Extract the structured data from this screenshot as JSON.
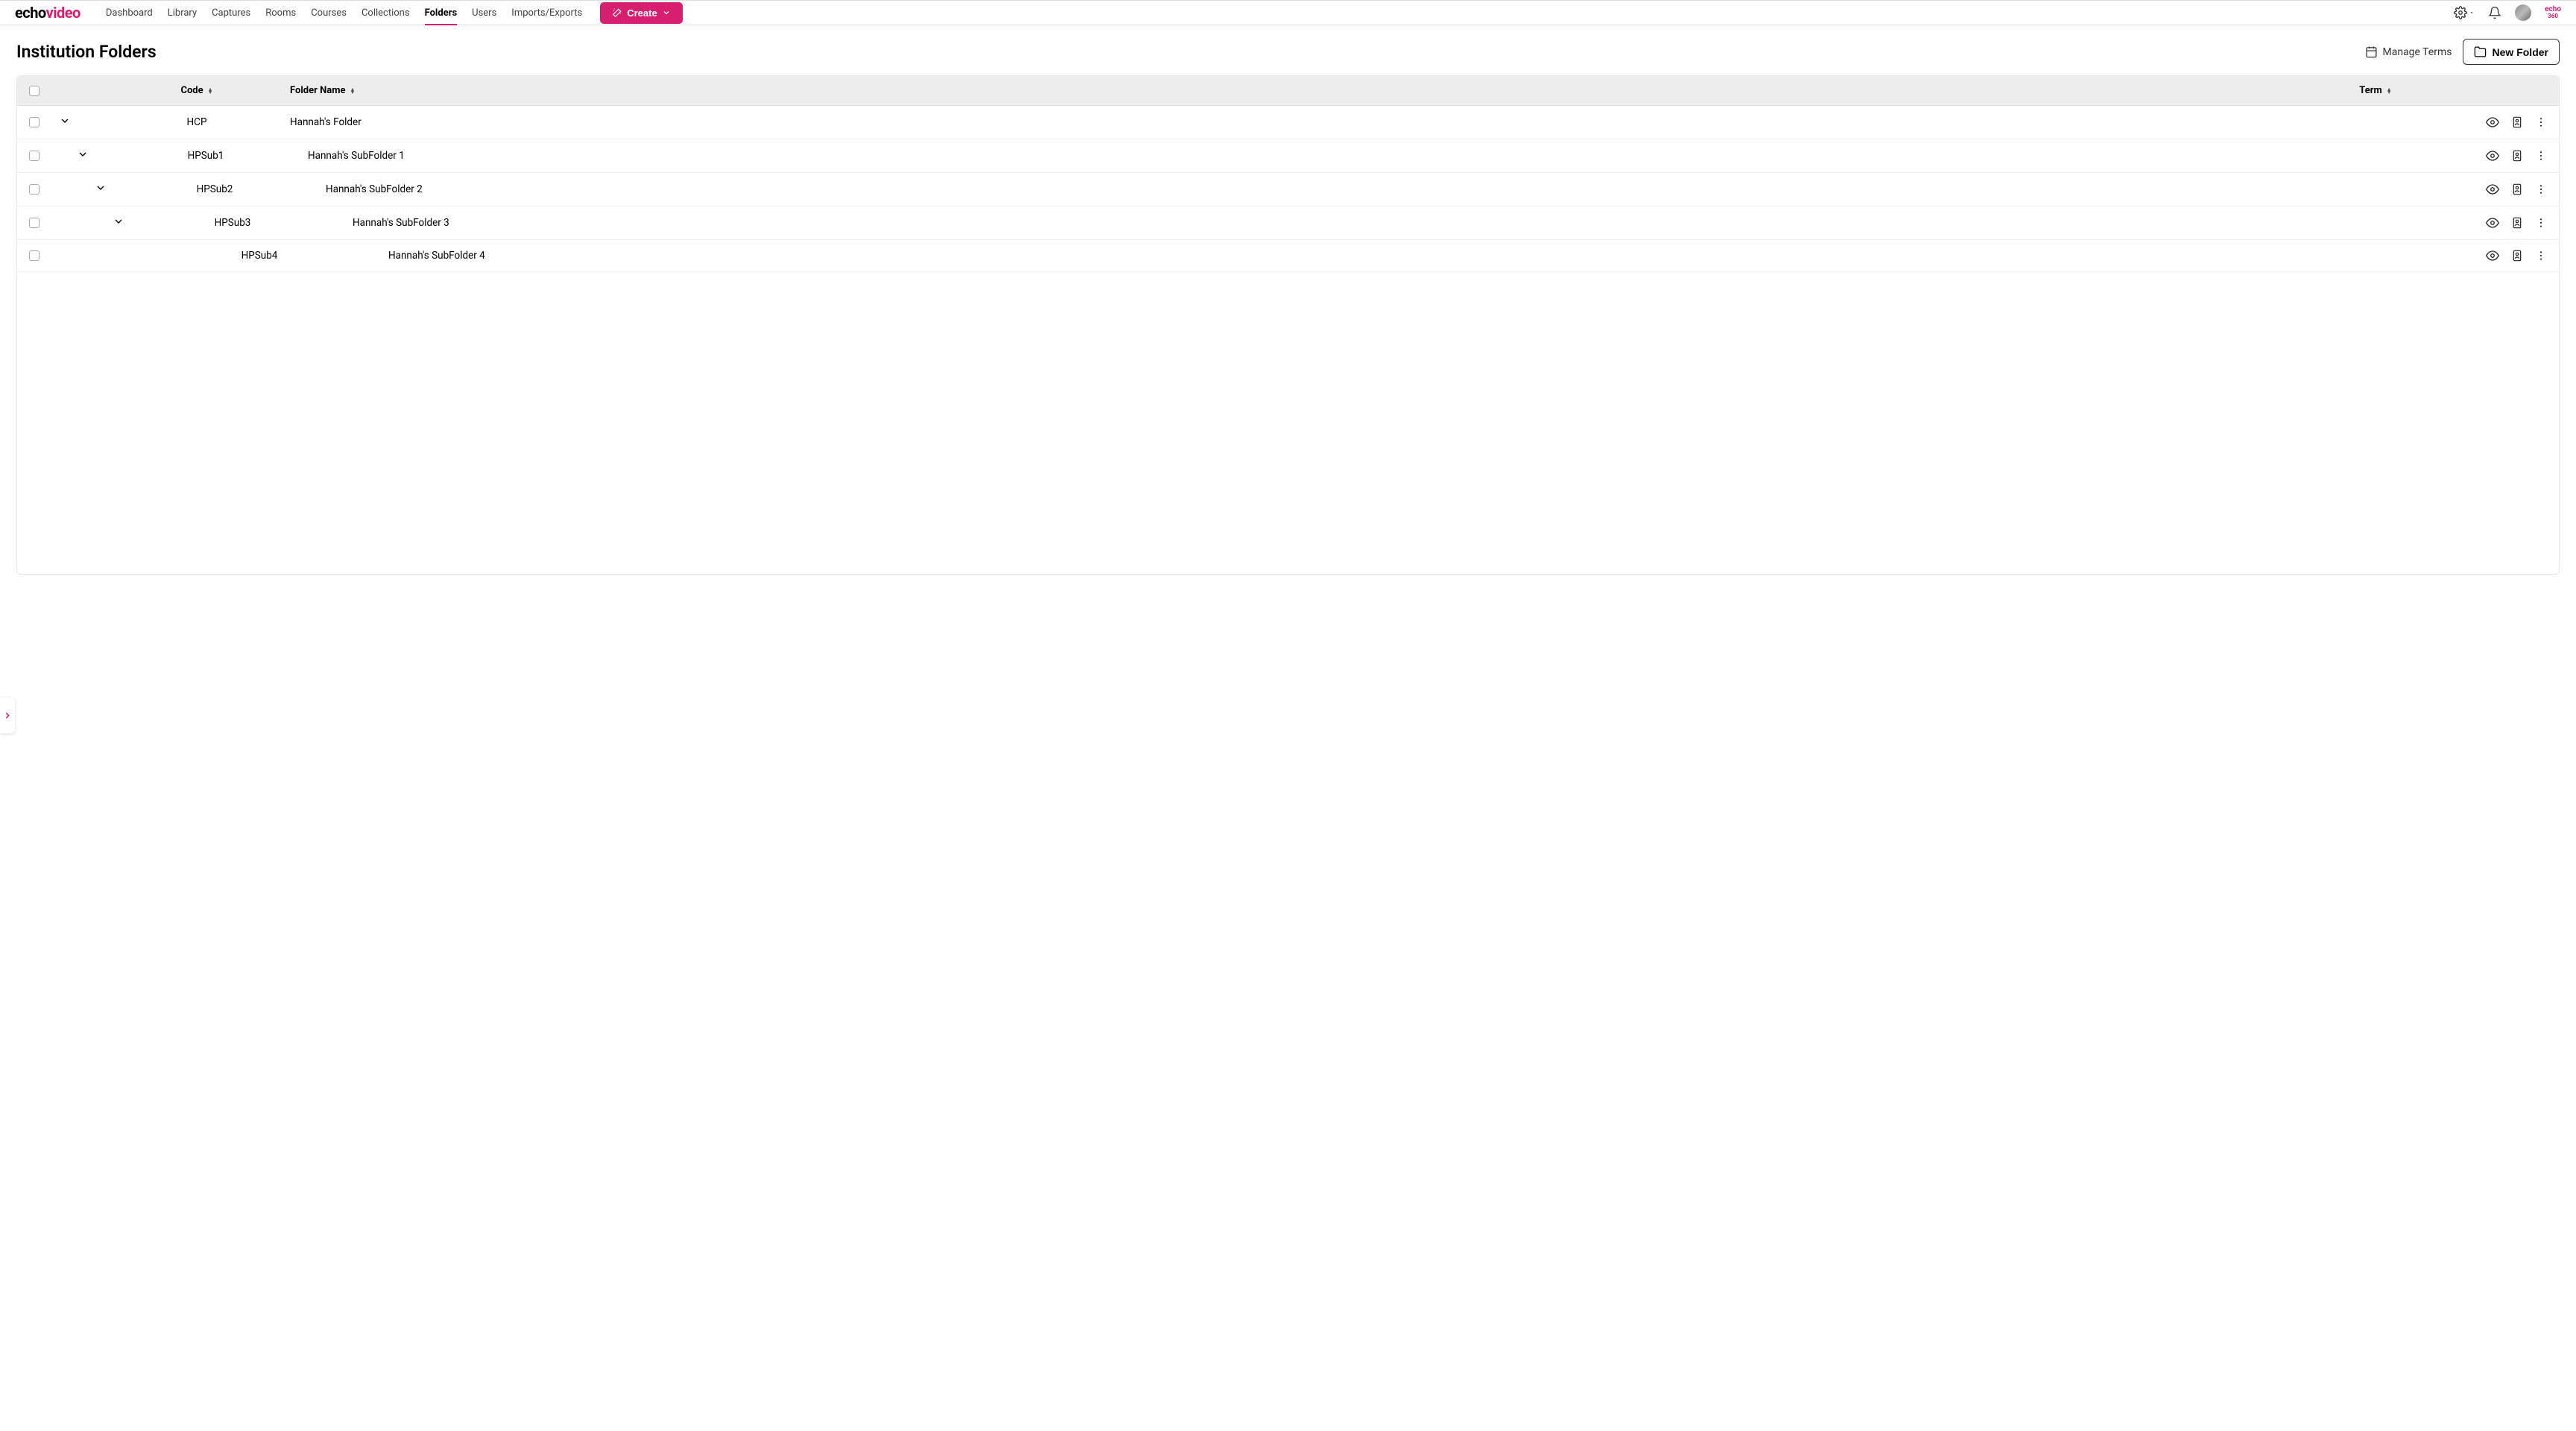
{
  "logo": {
    "part1": "echo",
    "part2": "video"
  },
  "nav": {
    "items": [
      {
        "label": "Dashboard",
        "active": false
      },
      {
        "label": "Library",
        "active": false
      },
      {
        "label": "Captures",
        "active": false
      },
      {
        "label": "Rooms",
        "active": false
      },
      {
        "label": "Courses",
        "active": false
      },
      {
        "label": "Collections",
        "active": false
      },
      {
        "label": "Folders",
        "active": true
      },
      {
        "label": "Users",
        "active": false
      },
      {
        "label": "Imports/Exports",
        "active": false
      }
    ],
    "create_label": "Create"
  },
  "brand_small": {
    "line1": "echo",
    "line2": "360"
  },
  "page": {
    "title": "Institution Folders",
    "manage_terms": "Manage Terms",
    "new_folder": "New Folder"
  },
  "table": {
    "headers": {
      "code": "Code",
      "name": "Folder Name",
      "term": "Term"
    },
    "rows": [
      {
        "code": "HCP",
        "name": "Hannah's Folder",
        "term": "",
        "indent": 0,
        "expandable": true
      },
      {
        "code": "HPSub1",
        "name": "Hannah's SubFolder 1",
        "term": "",
        "indent": 1,
        "expandable": true
      },
      {
        "code": "HPSub2",
        "name": "Hannah's SubFolder 2",
        "term": "",
        "indent": 2,
        "expandable": true
      },
      {
        "code": "HPSub3",
        "name": "Hannah's SubFolder 3",
        "term": "",
        "indent": 3,
        "expandable": true
      },
      {
        "code": "HPSub4",
        "name": "Hannah's SubFolder 4",
        "term": "",
        "indent": 4,
        "expandable": false
      }
    ]
  }
}
